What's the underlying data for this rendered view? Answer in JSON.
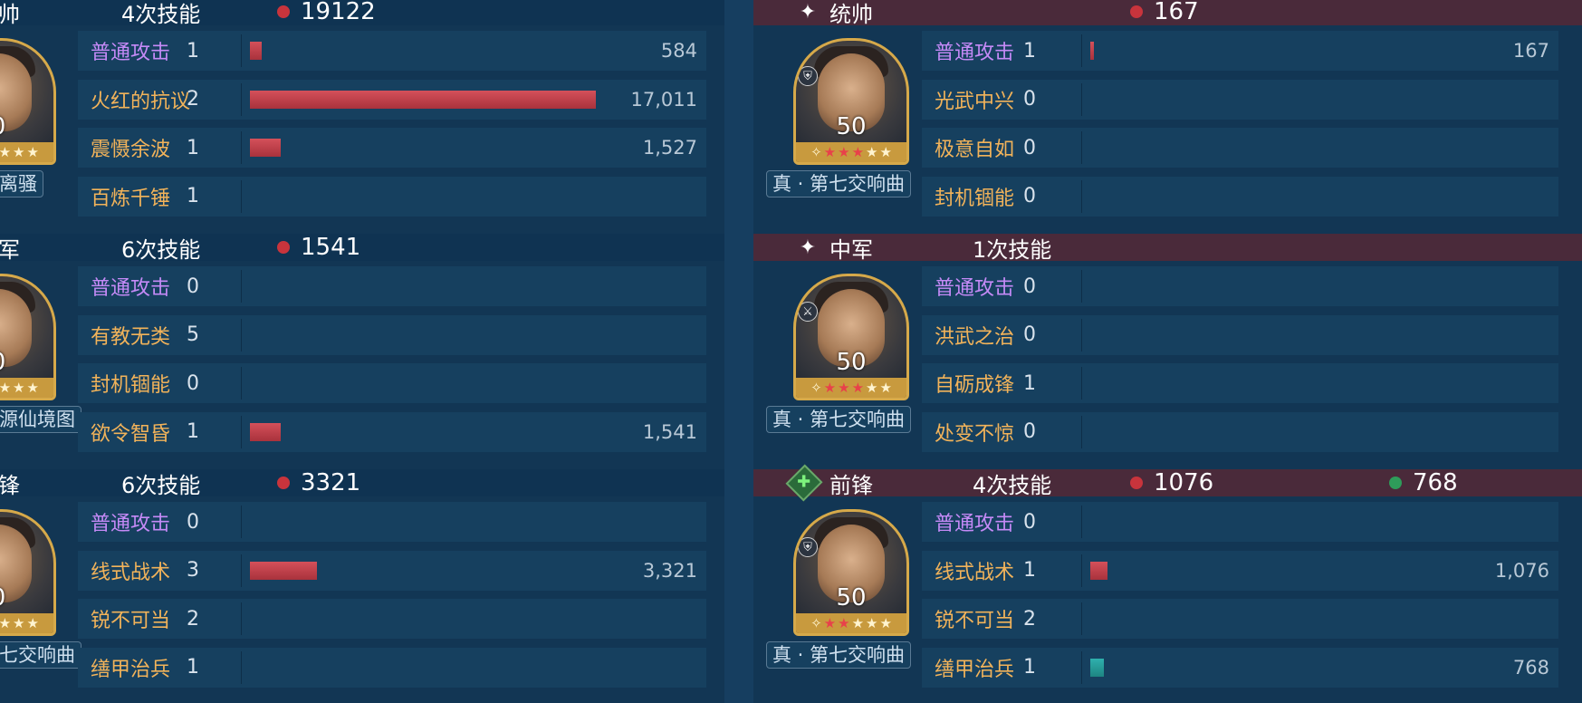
{
  "left": {
    "sections": [
      {
        "role": "帅",
        "times": "4次技能",
        "value1": "19122",
        "level": "0",
        "tag": "离骚",
        "skills": [
          {
            "name": "普通攻击",
            "count": "1",
            "value": "584",
            "share": 0.034,
            "type": "basic"
          },
          {
            "name": "火红的抗议",
            "count": "2",
            "value": "17,011",
            "share": 1.0,
            "type": "skill"
          },
          {
            "name": "震慑余波",
            "count": "1",
            "value": "1,527",
            "share": 0.09,
            "type": "skill"
          },
          {
            "name": "百炼千锤",
            "count": "1",
            "value": "",
            "share": 0,
            "type": "skill"
          }
        ]
      },
      {
        "role": "军",
        "times": "6次技能",
        "value1": "1541",
        "level": "0",
        "tag": "源仙境图",
        "skills": [
          {
            "name": "普通攻击",
            "count": "0",
            "value": "",
            "share": 0,
            "type": "basic"
          },
          {
            "name": "有教无类",
            "count": "5",
            "value": "",
            "share": 0,
            "type": "skill"
          },
          {
            "name": "封机锢能",
            "count": "0",
            "value": "",
            "share": 0,
            "type": "skill"
          },
          {
            "name": "欲令智昏",
            "count": "1",
            "value": "1,541",
            "share": 0.09,
            "type": "skill"
          }
        ]
      },
      {
        "role": "锋",
        "times": "6次技能",
        "value1": "3321",
        "level": "0",
        "tag": "七交响曲",
        "skills": [
          {
            "name": "普通攻击",
            "count": "0",
            "value": "",
            "share": 0,
            "type": "basic"
          },
          {
            "name": "线式战术",
            "count": "3",
            "value": "3,321",
            "share": 0.195,
            "type": "skill"
          },
          {
            "name": "锐不可当",
            "count": "2",
            "value": "",
            "share": 0,
            "type": "skill"
          },
          {
            "name": "缮甲治兵",
            "count": "1",
            "value": "",
            "share": 0,
            "type": "skill"
          }
        ]
      }
    ]
  },
  "right": {
    "sections": [
      {
        "role": "统帅",
        "times": "",
        "value1": "167",
        "value2": "",
        "level": "50",
        "tag": "真 · 第七交响曲",
        "skills": [
          {
            "name": "普通攻击",
            "count": "1",
            "value": "167",
            "share": 0.006,
            "type": "basic"
          },
          {
            "name": "光武中兴",
            "count": "0",
            "value": "",
            "share": 0,
            "type": "skill"
          },
          {
            "name": "极意自如",
            "count": "0",
            "value": "",
            "share": 0,
            "type": "skill"
          },
          {
            "name": "封机锢能",
            "count": "0",
            "value": "",
            "share": 0,
            "type": "skill"
          }
        ]
      },
      {
        "role": "中军",
        "times": "1次技能",
        "value1": "",
        "value2": "",
        "level": "50",
        "tag": "真 · 第七交响曲",
        "skills": [
          {
            "name": "普通攻击",
            "count": "0",
            "value": "",
            "share": 0,
            "type": "basic"
          },
          {
            "name": "洪武之治",
            "count": "0",
            "value": "",
            "share": 0,
            "type": "skill"
          },
          {
            "name": "自砺成锋",
            "count": "1",
            "value": "",
            "share": 0,
            "type": "skill"
          },
          {
            "name": "处变不惊",
            "count": "0",
            "value": "",
            "share": 0,
            "type": "skill"
          }
        ]
      },
      {
        "role": "前锋",
        "times": "4次技能",
        "value1": "1076",
        "value2": "768",
        "level": "50",
        "tag": "真 · 第七交响曲",
        "skills": [
          {
            "name": "普通攻击",
            "count": "0",
            "value": "",
            "share": 0,
            "type": "basic"
          },
          {
            "name": "线式战术",
            "count": "1",
            "value": "1,076",
            "share": 0.05,
            "type": "skill"
          },
          {
            "name": "锐不可当",
            "count": "2",
            "value": "",
            "share": 0,
            "type": "skill"
          },
          {
            "name": "缮甲治兵",
            "count": "1",
            "value": "768",
            "share": 0.04,
            "type": "heal"
          }
        ]
      }
    ]
  },
  "icons": {
    "sparkle": "sparkle-icon",
    "heal_badge": "heal-badge-icon",
    "weapon_badge": "weapon-badge-icon"
  },
  "colors": {
    "damage_bar": "#c8343c",
    "heal_bar": "#26a09d",
    "basic_attack_label": "#c58af7",
    "skill_label": "#f2b35a"
  }
}
